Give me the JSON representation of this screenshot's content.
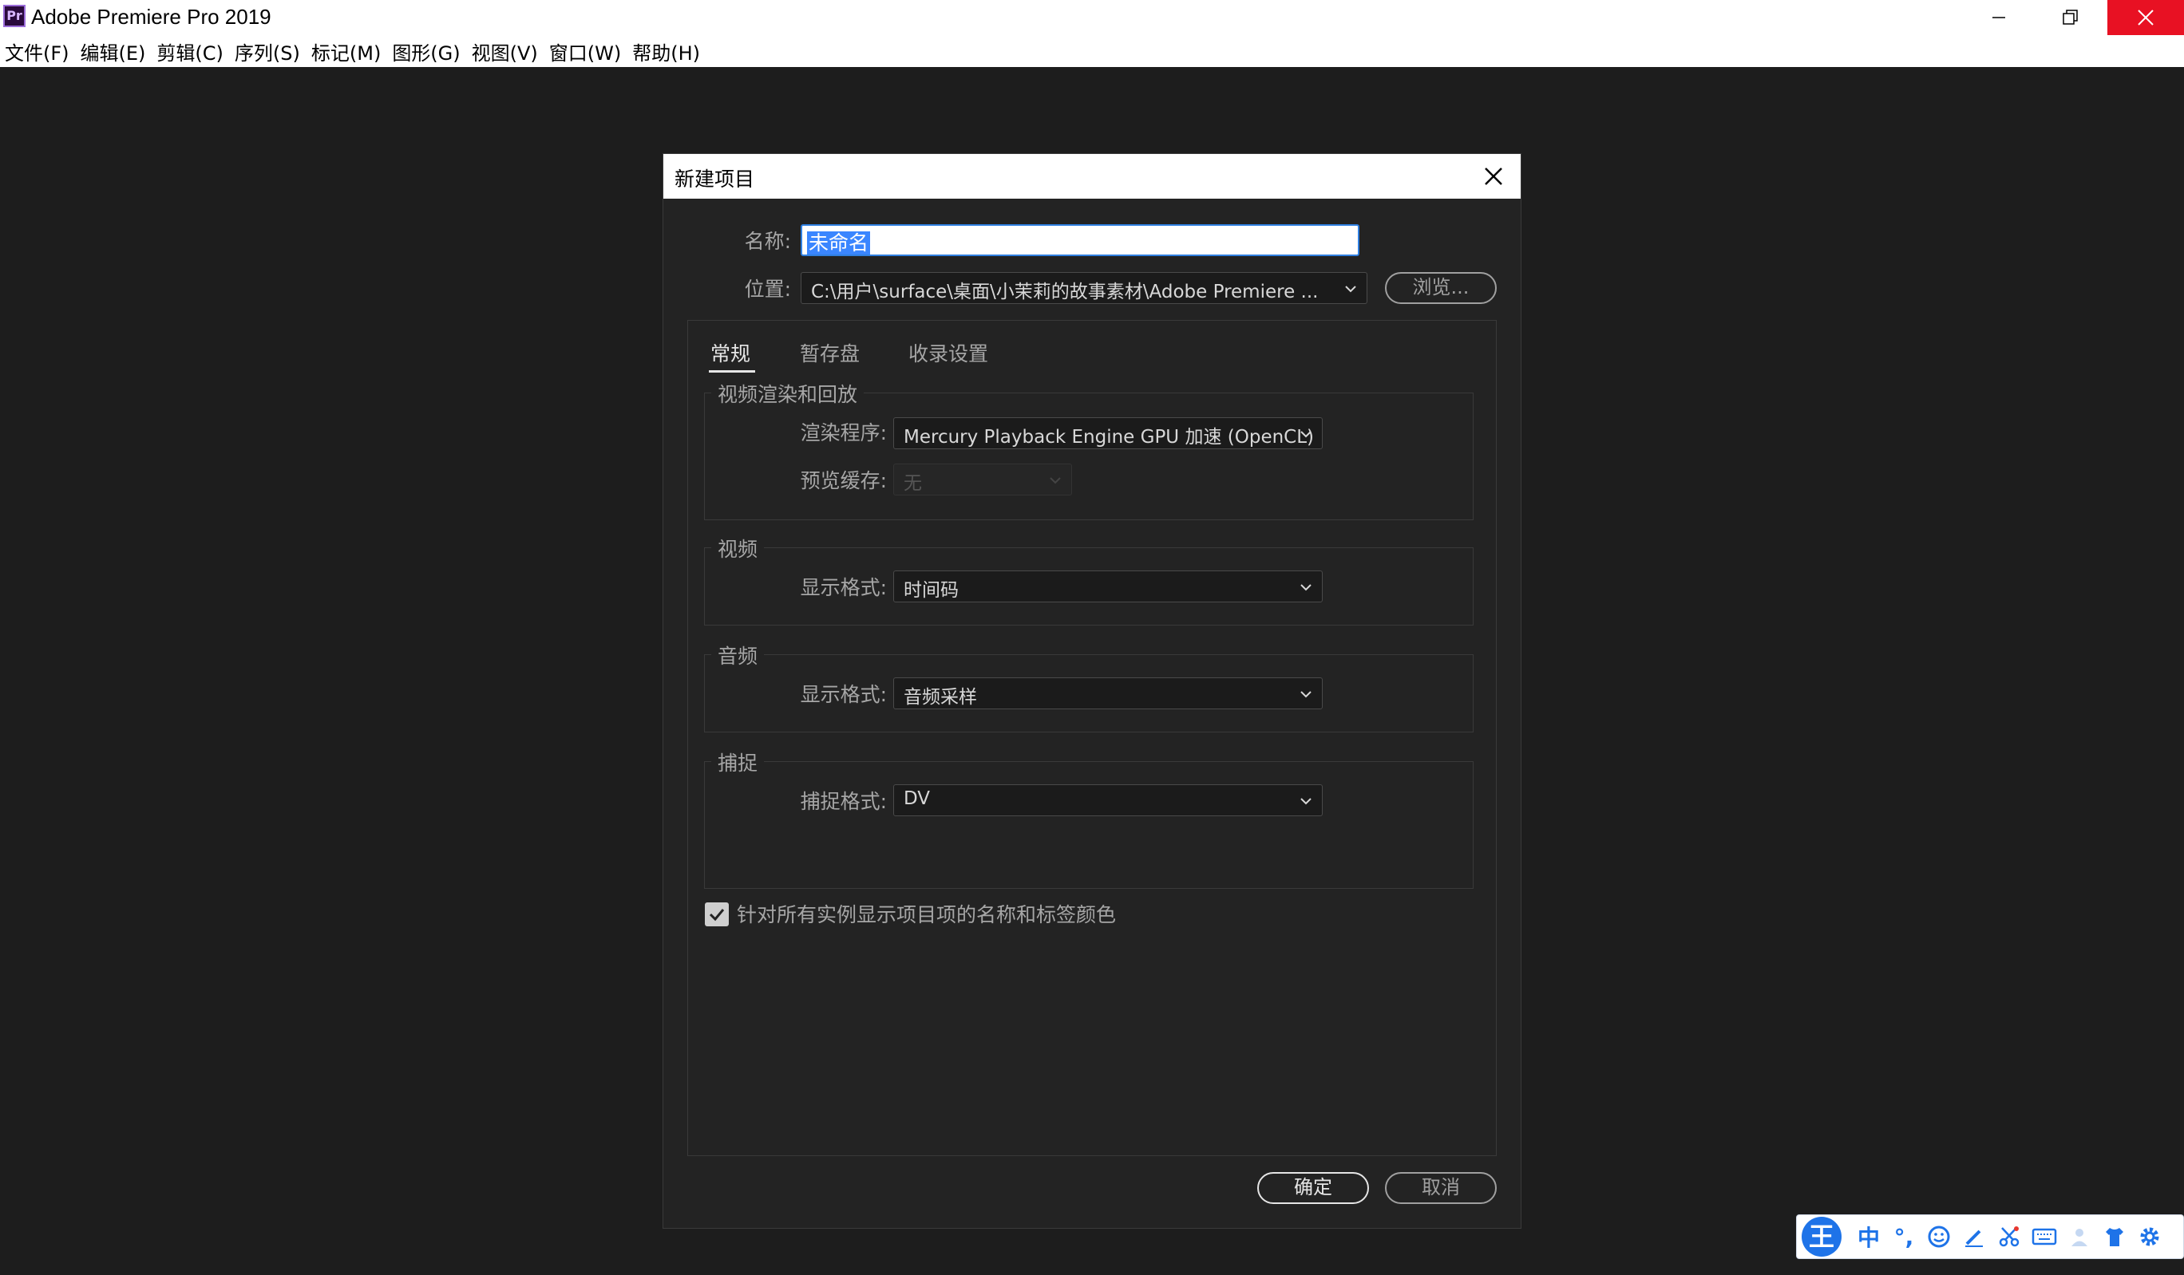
{
  "window": {
    "icon_text": "Pr",
    "title": "Adobe Premiere Pro 2019"
  },
  "menu": [
    "文件(F)",
    "编辑(E)",
    "剪辑(C)",
    "序列(S)",
    "标记(M)",
    "图形(G)",
    "视图(V)",
    "窗口(W)",
    "帮助(H)"
  ],
  "dialog": {
    "title": "新建项目",
    "name_label": "名称:",
    "name_value": "未命名",
    "location_label": "位置:",
    "location_value": "C:\\用户\\surface\\桌面\\小茉莉的故事素材\\Adobe Premiere ...",
    "browse_label": "浏览...",
    "tabs": [
      "常规",
      "暂存盘",
      "收录设置"
    ],
    "video_render": {
      "group_title": "视频渲染和回放",
      "renderer_label": "渲染程序:",
      "renderer_value": "Mercury Playback Engine GPU 加速 (OpenCL)",
      "preview_cache_label": "预览缓存:",
      "preview_cache_value": "无"
    },
    "video": {
      "group_title": "视频",
      "display_format_label": "显示格式:",
      "display_format_value": "时间码"
    },
    "audio": {
      "group_title": "音频",
      "display_format_label": "显示格式:",
      "display_format_value": "音频采样"
    },
    "capture": {
      "group_title": "捕捉",
      "capture_format_label": "捕捉格式:",
      "capture_format_value": "DV"
    },
    "checkbox_label": "针对所有实例显示项目项的名称和标签颜色",
    "ok_label": "确定",
    "cancel_label": "取消"
  },
  "ime": {
    "logo": "王",
    "mode": "中",
    "punct": "°,"
  },
  "colors": {
    "background": "#1d1d1d",
    "dialog_bg": "#232323",
    "accent": "#2f7fe0",
    "close_red": "#e81123",
    "ime_blue": "#1e73e8"
  }
}
